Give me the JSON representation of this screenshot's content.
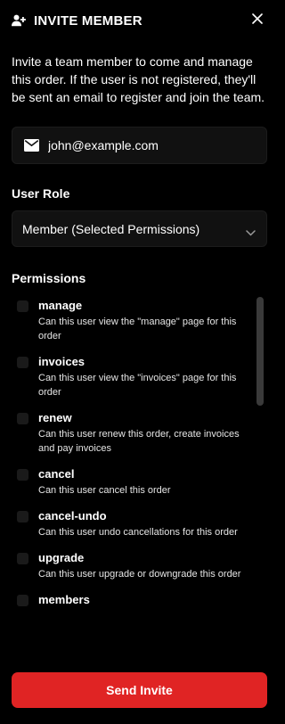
{
  "header": {
    "title": "INVITE MEMBER",
    "icon": "user-plus-icon",
    "close_icon": "close-icon"
  },
  "description": "Invite a team member to come and manage this order. If the user is not registered, they'll be sent an email to register and join the team.",
  "email": {
    "icon": "mail-icon",
    "value": "john@example.com"
  },
  "role": {
    "label": "User Role",
    "selected": "Member (Selected Permissions)",
    "icon": "chevron-down-icon"
  },
  "permissions": {
    "label": "Permissions",
    "items": [
      {
        "name": "manage",
        "description": "Can this user view the \"manage\" page for this order",
        "checked": false
      },
      {
        "name": "invoices",
        "description": "Can this user view the \"invoices\" page for this order",
        "checked": false
      },
      {
        "name": "renew",
        "description": "Can this user renew this order, create invoices and pay invoices",
        "checked": false
      },
      {
        "name": "cancel",
        "description": "Can this user cancel this order",
        "checked": false
      },
      {
        "name": "cancel-undo",
        "description": "Can this user undo cancellations for this order",
        "checked": false
      },
      {
        "name": "upgrade",
        "description": "Can this user upgrade or downgrade this order",
        "checked": false
      },
      {
        "name": "members",
        "description": "",
        "checked": false
      }
    ]
  },
  "submit_label": "Send Invite",
  "colors": {
    "background": "#000000",
    "field": "#111111",
    "accent": "#e02424"
  }
}
